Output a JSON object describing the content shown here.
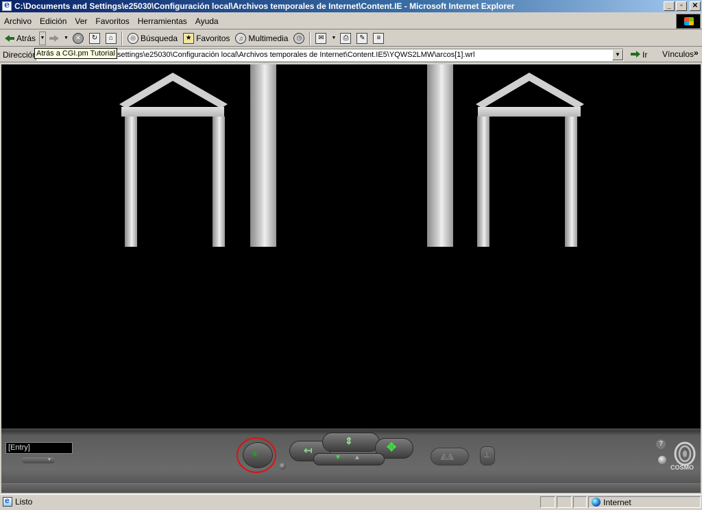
{
  "window": {
    "title": "C:\\Documents and Settings\\e25030\\Configuración local\\Archivos temporales de Internet\\Content.IE - Microsoft Internet Explorer",
    "minimize": "_",
    "maximize": "▫",
    "close": "✕"
  },
  "menu": {
    "items": [
      "Archivo",
      "Edición",
      "Ver",
      "Favoritos",
      "Herramientas",
      "Ayuda"
    ]
  },
  "toolbar": {
    "back_label": "Atrás",
    "search_label": "Búsqueda",
    "favorites_label": "Favoritos",
    "media_label": "Multimedia"
  },
  "address": {
    "label": "Dirección",
    "value": "settings\\e25030\\Configuración local\\Archivos temporales de Internet\\Content.IE5\\YQWS2LMW\\arcos[1].wrl",
    "go_label": "Ir",
    "links_label": "Vínculos",
    "tooltip": "Atrás a CGI.pm Tutorial"
  },
  "cosmo": {
    "viewpoint_value": "[Entry]",
    "logo_text": "COSMO",
    "help": "?"
  },
  "status": {
    "text": "Listo",
    "zone": "Internet"
  },
  "colors": {
    "title_gradient_start": "#0a246a",
    "title_gradient_end": "#a6caf0",
    "chrome": "#d4d0c8",
    "viewport_bg": "#000000",
    "nav_green": "#3ce03c",
    "highlight_red": "#e01010"
  }
}
